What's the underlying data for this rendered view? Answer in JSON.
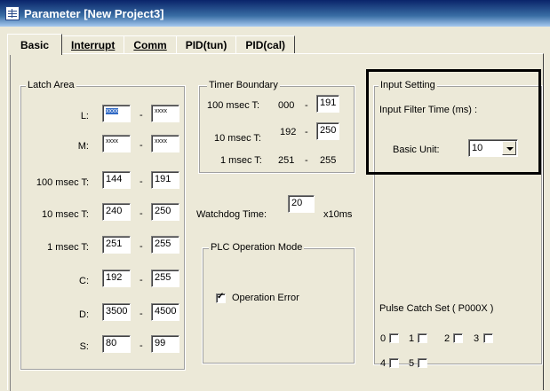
{
  "window": {
    "title": "Parameter [New Project3]",
    "icon": "parameter-app-icon"
  },
  "tabs": [
    {
      "label": "Basic"
    },
    {
      "label": "Interrupt"
    },
    {
      "label": "Comm"
    },
    {
      "label": "PID(tun)"
    },
    {
      "label": "PID(cal)"
    }
  ],
  "latch": {
    "legend": "Latch Area",
    "rows": [
      {
        "label": "L:",
        "from": "xxxx",
        "to": "xxxx"
      },
      {
        "label": "M:",
        "from": "xxxx",
        "to": "xxxx"
      },
      {
        "label": "100 msec T:",
        "from": "144",
        "to": "191"
      },
      {
        "label": "10 msec T:",
        "from": "240",
        "to": "250"
      },
      {
        "label": "1 msec T:",
        "from": "251",
        "to": "255"
      },
      {
        "label": "C:",
        "from": "192",
        "to": "255"
      },
      {
        "label": "D:",
        "from": "3500",
        "to": "4500"
      },
      {
        "label": "S:",
        "from": "80",
        "to": "99"
      }
    ],
    "separator": "-"
  },
  "timer": {
    "legend": "Timer Boundary",
    "rows": [
      {
        "label": "100 msec T:",
        "from": "000",
        "to": "191"
      },
      {
        "label": "10 msec T:",
        "from": "192",
        "to": "250"
      },
      {
        "label": "1 msec T:",
        "from": "251",
        "to": "255"
      }
    ],
    "separator": "-"
  },
  "watchdog": {
    "label": "Watchdog Time:",
    "value": "20",
    "unit": "x10ms"
  },
  "plc_mode": {
    "legend": "PLC Operation Mode",
    "operation_error_label": "Operation Error",
    "operation_error_checked": true
  },
  "input": {
    "legend": "Input Setting",
    "filter_label": "Input Filter Time (ms) :",
    "basic_unit_label": "Basic Unit:",
    "basic_unit_value": "10"
  },
  "pulse": {
    "label": "Pulse Catch Set ( P000X )",
    "bits": [
      "0",
      "1",
      "2",
      "3",
      "4",
      "5"
    ]
  }
}
